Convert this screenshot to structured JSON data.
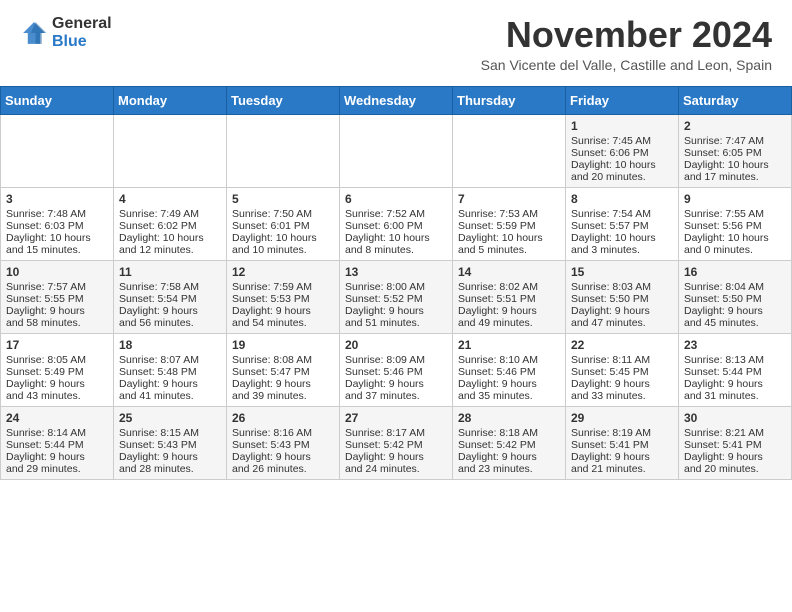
{
  "header": {
    "logo_general": "General",
    "logo_blue": "Blue",
    "month_title": "November 2024",
    "location": "San Vicente del Valle, Castille and Leon, Spain"
  },
  "weekdays": [
    "Sunday",
    "Monday",
    "Tuesday",
    "Wednesday",
    "Thursday",
    "Friday",
    "Saturday"
  ],
  "weeks": [
    [
      {
        "day": "",
        "info": ""
      },
      {
        "day": "",
        "info": ""
      },
      {
        "day": "",
        "info": ""
      },
      {
        "day": "",
        "info": ""
      },
      {
        "day": "",
        "info": ""
      },
      {
        "day": "1",
        "info": "Sunrise: 7:45 AM\nSunset: 6:06 PM\nDaylight: 10 hours\nand 20 minutes."
      },
      {
        "day": "2",
        "info": "Sunrise: 7:47 AM\nSunset: 6:05 PM\nDaylight: 10 hours\nand 17 minutes."
      }
    ],
    [
      {
        "day": "3",
        "info": "Sunrise: 7:48 AM\nSunset: 6:03 PM\nDaylight: 10 hours\nand 15 minutes."
      },
      {
        "day": "4",
        "info": "Sunrise: 7:49 AM\nSunset: 6:02 PM\nDaylight: 10 hours\nand 12 minutes."
      },
      {
        "day": "5",
        "info": "Sunrise: 7:50 AM\nSunset: 6:01 PM\nDaylight: 10 hours\nand 10 minutes."
      },
      {
        "day": "6",
        "info": "Sunrise: 7:52 AM\nSunset: 6:00 PM\nDaylight: 10 hours\nand 8 minutes."
      },
      {
        "day": "7",
        "info": "Sunrise: 7:53 AM\nSunset: 5:59 PM\nDaylight: 10 hours\nand 5 minutes."
      },
      {
        "day": "8",
        "info": "Sunrise: 7:54 AM\nSunset: 5:57 PM\nDaylight: 10 hours\nand 3 minutes."
      },
      {
        "day": "9",
        "info": "Sunrise: 7:55 AM\nSunset: 5:56 PM\nDaylight: 10 hours\nand 0 minutes."
      }
    ],
    [
      {
        "day": "10",
        "info": "Sunrise: 7:57 AM\nSunset: 5:55 PM\nDaylight: 9 hours\nand 58 minutes."
      },
      {
        "day": "11",
        "info": "Sunrise: 7:58 AM\nSunset: 5:54 PM\nDaylight: 9 hours\nand 56 minutes."
      },
      {
        "day": "12",
        "info": "Sunrise: 7:59 AM\nSunset: 5:53 PM\nDaylight: 9 hours\nand 54 minutes."
      },
      {
        "day": "13",
        "info": "Sunrise: 8:00 AM\nSunset: 5:52 PM\nDaylight: 9 hours\nand 51 minutes."
      },
      {
        "day": "14",
        "info": "Sunrise: 8:02 AM\nSunset: 5:51 PM\nDaylight: 9 hours\nand 49 minutes."
      },
      {
        "day": "15",
        "info": "Sunrise: 8:03 AM\nSunset: 5:50 PM\nDaylight: 9 hours\nand 47 minutes."
      },
      {
        "day": "16",
        "info": "Sunrise: 8:04 AM\nSunset: 5:50 PM\nDaylight: 9 hours\nand 45 minutes."
      }
    ],
    [
      {
        "day": "17",
        "info": "Sunrise: 8:05 AM\nSunset: 5:49 PM\nDaylight: 9 hours\nand 43 minutes."
      },
      {
        "day": "18",
        "info": "Sunrise: 8:07 AM\nSunset: 5:48 PM\nDaylight: 9 hours\nand 41 minutes."
      },
      {
        "day": "19",
        "info": "Sunrise: 8:08 AM\nSunset: 5:47 PM\nDaylight: 9 hours\nand 39 minutes."
      },
      {
        "day": "20",
        "info": "Sunrise: 8:09 AM\nSunset: 5:46 PM\nDaylight: 9 hours\nand 37 minutes."
      },
      {
        "day": "21",
        "info": "Sunrise: 8:10 AM\nSunset: 5:46 PM\nDaylight: 9 hours\nand 35 minutes."
      },
      {
        "day": "22",
        "info": "Sunrise: 8:11 AM\nSunset: 5:45 PM\nDaylight: 9 hours\nand 33 minutes."
      },
      {
        "day": "23",
        "info": "Sunrise: 8:13 AM\nSunset: 5:44 PM\nDaylight: 9 hours\nand 31 minutes."
      }
    ],
    [
      {
        "day": "24",
        "info": "Sunrise: 8:14 AM\nSunset: 5:44 PM\nDaylight: 9 hours\nand 29 minutes."
      },
      {
        "day": "25",
        "info": "Sunrise: 8:15 AM\nSunset: 5:43 PM\nDaylight: 9 hours\nand 28 minutes."
      },
      {
        "day": "26",
        "info": "Sunrise: 8:16 AM\nSunset: 5:43 PM\nDaylight: 9 hours\nand 26 minutes."
      },
      {
        "day": "27",
        "info": "Sunrise: 8:17 AM\nSunset: 5:42 PM\nDaylight: 9 hours\nand 24 minutes."
      },
      {
        "day": "28",
        "info": "Sunrise: 8:18 AM\nSunset: 5:42 PM\nDaylight: 9 hours\nand 23 minutes."
      },
      {
        "day": "29",
        "info": "Sunrise: 8:19 AM\nSunset: 5:41 PM\nDaylight: 9 hours\nand 21 minutes."
      },
      {
        "day": "30",
        "info": "Sunrise: 8:21 AM\nSunset: 5:41 PM\nDaylight: 9 hours\nand 20 minutes."
      }
    ]
  ]
}
